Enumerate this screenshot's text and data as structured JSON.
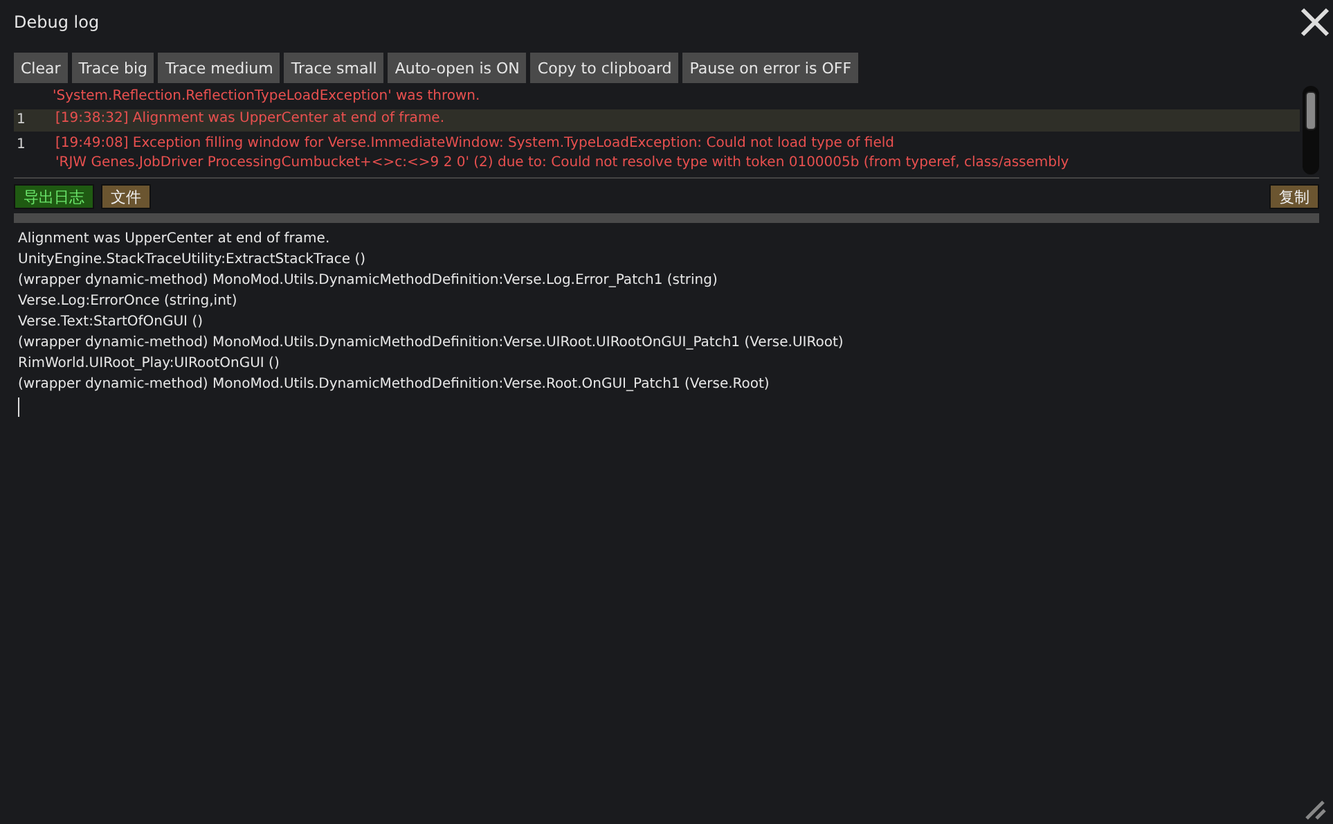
{
  "window": {
    "title": "Debug log"
  },
  "toolbar": [
    {
      "label": "Clear"
    },
    {
      "label": "Trace big"
    },
    {
      "label": "Trace medium"
    },
    {
      "label": "Trace small"
    },
    {
      "label": "Auto-open is ON"
    },
    {
      "label": "Copy to clipboard"
    },
    {
      "label": "Pause on error is OFF"
    }
  ],
  "log": [
    {
      "lines": [
        "'System.Reflection.ReflectionTypeLoadException' was thrown."
      ],
      "selected": false
    },
    {
      "count": "1",
      "lines": [
        "[19:38:32] Alignment was UpperCenter at end of frame."
      ],
      "selected": true
    },
    {
      "count": "1",
      "lines": [
        "[19:49:08] Exception filling window for Verse.ImmediateWindow: System.TypeLoadException: Could not load type of field",
        "'RJW  Genes.JobDriver  ProcessingCumbucket+<>c:<>9   2  0' (2) due to: Could not resolve type with token 0100005b (from typeref, class/assembly"
      ],
      "selected": false
    }
  ],
  "actions": [
    {
      "label": "导出日志",
      "kind": "green"
    },
    {
      "label": "文件",
      "kind": "brown"
    },
    {
      "label": "复制",
      "kind": "brown"
    }
  ],
  "detail": [
    "Alignment was UpperCenter at end of frame.",
    "UnityEngine.StackTraceUtility:ExtractStackTrace ()",
    "(wrapper dynamic-method) MonoMod.Utils.DynamicMethodDefinition:Verse.Log.Error_Patch1 (string)",
    "Verse.Log:ErrorOnce (string,int)",
    "Verse.Text:StartOfOnGUI ()",
    "(wrapper dynamic-method) MonoMod.Utils.DynamicMethodDefinition:Verse.UIRoot.UIRootOnGUI_Patch1 (Verse.UIRoot)",
    "RimWorld.UIRoot_Play:UIRootOnGUI ()",
    "(wrapper dynamic-method) MonoMod.Utils.DynamicMethodDefinition:Verse.Root.OnGUI_Patch1 (Verse.Root)"
  ]
}
